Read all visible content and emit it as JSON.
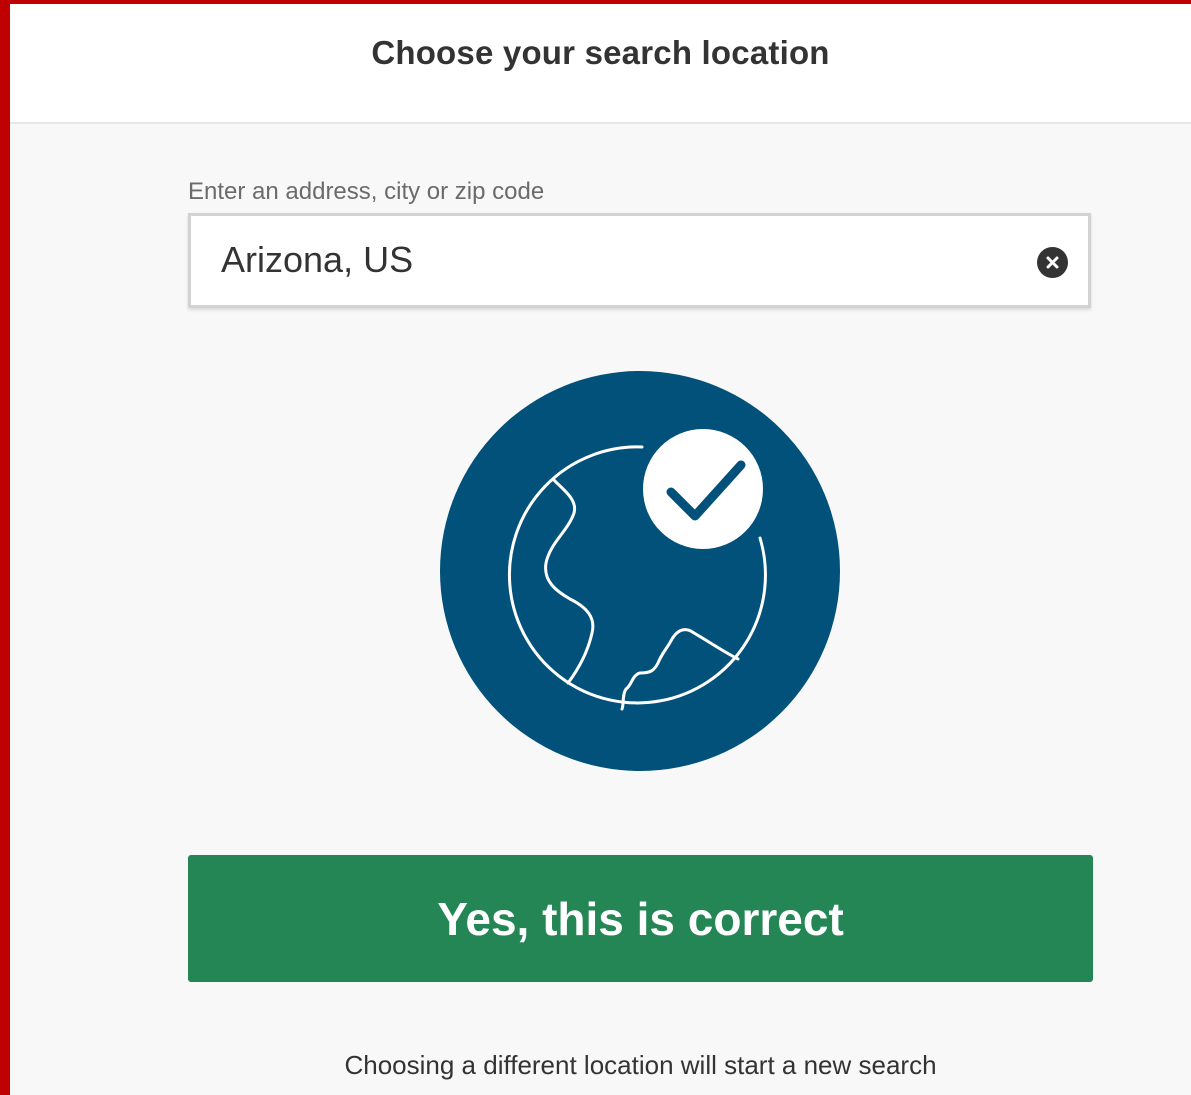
{
  "header": {
    "title": "Choose your search location"
  },
  "location_input": {
    "label": "Enter an address, city or zip code",
    "value": "Arizona, US",
    "clear_icon": "close-circle-icon"
  },
  "illustration": {
    "icon": "globe-check-icon"
  },
  "confirm_button": {
    "label": "Yes, this is correct"
  },
  "footnote": "Choosing a different location will start a new search",
  "colors": {
    "frame_accent": "#c00000",
    "globe_bg": "#02517a",
    "button_bg": "#238654",
    "text": "#333333",
    "label": "#6b6b6b"
  }
}
